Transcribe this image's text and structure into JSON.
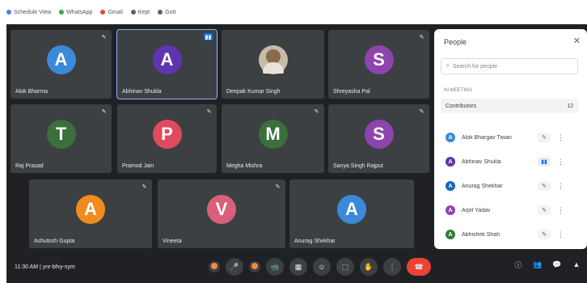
{
  "bookmarks": [
    {
      "label": "Schedule View",
      "color": "#4285f4"
    },
    {
      "label": "WhatsApp",
      "color": "#34a853"
    },
    {
      "label": "Gmail",
      "color": "#ea4335"
    },
    {
      "label": "Kept",
      "color": "#5f6368"
    },
    {
      "label": "Gott",
      "color": "#5f6368"
    }
  ],
  "tiles": [
    {
      "name": "Alok Bharma",
      "initial": "A",
      "color": "#3b8ad9",
      "mic": "✎"
    },
    {
      "name": "Abhinav Shukla",
      "initial": "A",
      "color": "#5e35b1",
      "mic": "▮▮",
      "active": true
    },
    {
      "name": "Deepak Kumar Singh",
      "initial": "",
      "color": "#c7bba7",
      "mic": "",
      "photo": true
    },
    {
      "name": "Shreyasha Pal",
      "initial": "S",
      "color": "#8e44ad",
      "mic": "✎"
    },
    {
      "name": "Raj Prasad",
      "initial": "T",
      "color": "#3b6f3b",
      "mic": "✎"
    },
    {
      "name": "Pramod Jain",
      "initial": "P",
      "color": "#e04a5e",
      "mic": "✎"
    },
    {
      "name": "Megha Mishra",
      "initial": "M",
      "color": "#3b6f3b",
      "mic": "✎"
    },
    {
      "name": "Sanya Singh Rajput",
      "initial": "S",
      "color": "#8e44ad",
      "mic": "✎"
    },
    {
      "name": "Ashutosh Gupta",
      "initial": "A",
      "color": "#f08b1f",
      "mic": "✎"
    },
    {
      "name": "Vineeta",
      "initial": "V",
      "color": "#d95f7a",
      "mic": "✎"
    },
    {
      "name": "Anurag Shekhar",
      "initial": "A",
      "color": "#3b8ad9",
      "mic": ""
    }
  ],
  "panel": {
    "title": "People",
    "close_icon": "✕",
    "search_placeholder": "Search for people",
    "section_label": "IN MEETING",
    "group_label": "Contributors",
    "group_count": "12",
    "people": [
      {
        "name": "Alok Bhargav Tiwari",
        "initial": "A",
        "color": "#3b8ad9",
        "mic": "✎"
      },
      {
        "name": "Abhinav Shukla",
        "initial": "A",
        "color": "#5e35b1",
        "mic": "▮▮",
        "speaking": true
      },
      {
        "name": "Anurag Shekhar",
        "initial": "A",
        "color": "#1565c0",
        "mic": "✎"
      },
      {
        "name": "Arpit Yadav",
        "initial": "A",
        "color": "#8e44ad",
        "mic": "✎"
      },
      {
        "name": "Abhishek Shah",
        "initial": "A",
        "color": "#2e7d32",
        "mic": "✎"
      }
    ]
  },
  "bottom": {
    "time": "11:30 AM",
    "meeting_code": "ynr-bfxy-sym",
    "controls": [
      "^",
      "🎤",
      "^",
      "📹",
      "▦",
      "☺",
      "⬚",
      "✋",
      "⋮",
      "☎"
    ],
    "right_icons": [
      "ⓘ",
      "👥",
      "💬",
      "▲"
    ]
  }
}
